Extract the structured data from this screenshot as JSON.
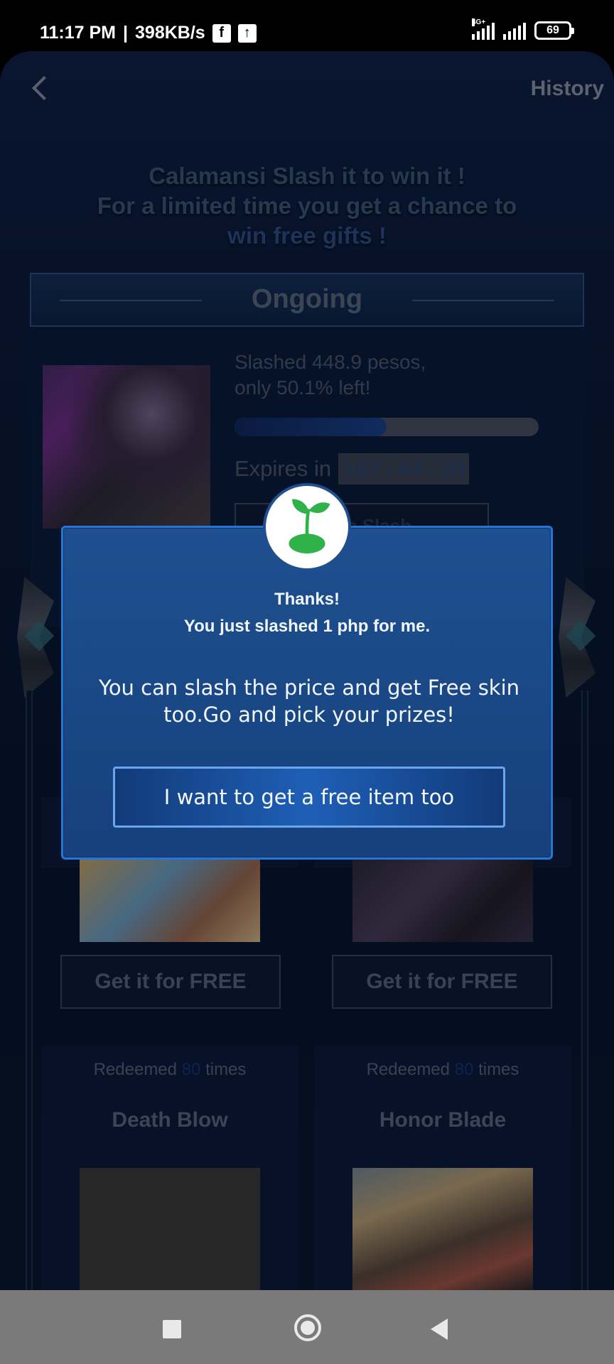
{
  "status_bar": {
    "time": "11:17 PM",
    "speed": "398KB/s",
    "network_tag": "4G+",
    "battery": "69",
    "icons": [
      "facebook-icon",
      "upload-icon",
      "signal-icon",
      "wifi-signal-icon",
      "battery-icon"
    ]
  },
  "header": {
    "back_icon": "chevron-left-icon",
    "history_label": "History"
  },
  "headline": {
    "line1": "Calamansi Slash it to win it !",
    "line2": "For a limited time you get a chance to",
    "line3": "win free gifts !"
  },
  "ongoing": {
    "label": "Ongoing",
    "slashed_line1": "Slashed 448.9 pesos,",
    "slashed_line2": "only 50.1% left!",
    "progress_fraction": 0.499,
    "expires_label": "Expires in",
    "timer": "167 : 44 : 20",
    "action_label": "Price Slash"
  },
  "products": {
    "row1": [
      {
        "button": "Get it for FREE"
      },
      {
        "button": "Get it for FREE"
      }
    ],
    "row2": [
      {
        "redeemed_prefix": "Redeemed",
        "redeemed_count": "80",
        "redeemed_suffix": "times",
        "title": "Death Blow"
      },
      {
        "redeemed_prefix": "Redeemed",
        "redeemed_count": "80",
        "redeemed_suffix": "times",
        "title": "Honor Blade"
      }
    ]
  },
  "modal": {
    "icon": "sprout-icon",
    "thanks": "Thanks!",
    "slashed_message": "You just slashed 1 php for me.",
    "body": "You can slash the price and get Free skin too.Go and pick your prizes!",
    "button_label": "I want to get a free item too"
  },
  "colors": {
    "modal_bg": "#1f4f8e",
    "modal_border": "#2377d9",
    "accent_green": "#2fb24a",
    "app_bg": "#0a1a3a"
  },
  "nav_bar": {
    "icons": [
      "recent-apps-icon",
      "home-icon",
      "back-icon"
    ]
  }
}
